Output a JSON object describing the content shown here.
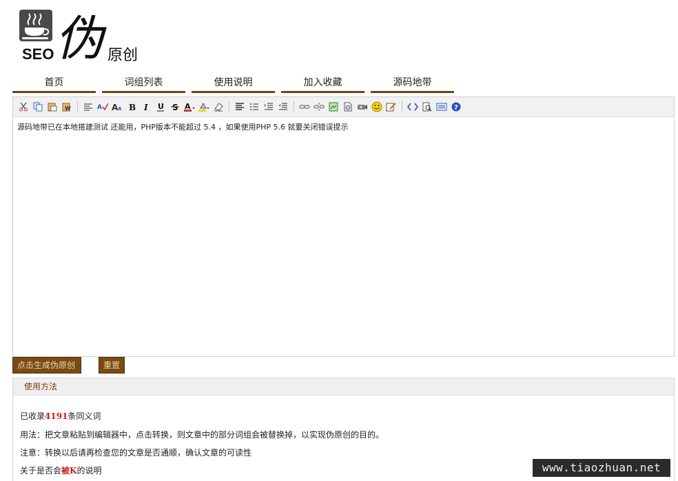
{
  "logo": {
    "seo_text": "SEO",
    "big_char": "伪",
    "small_text": "原创",
    "icon": "coffee-cup-icon"
  },
  "nav": {
    "items": [
      {
        "label": "首页"
      },
      {
        "label": "词组列表"
      },
      {
        "label": "使用说明"
      },
      {
        "label": "加入收藏"
      },
      {
        "label": "源码地带"
      }
    ]
  },
  "toolbar": {
    "buttons": [
      "cut-icon",
      "copy-icon",
      "paste-icon",
      "paste-text-icon",
      "format-icon",
      "spellcheck-icon",
      "font-size-icon",
      "bold-icon",
      "italic-icon",
      "underline-icon",
      "strikethrough-icon",
      "text-color-icon",
      "highlight-icon",
      "eraser-icon",
      "align-icon",
      "unordered-list-icon",
      "indent-icon",
      "outdent-icon",
      "link-icon",
      "unlink-icon",
      "image-icon",
      "flash-icon",
      "media-icon",
      "emoticon-icon",
      "edit-icon",
      "source-icon",
      "preview-icon",
      "fullscreen-icon",
      "help-icon"
    ]
  },
  "editor": {
    "content": "源码地带已在本地搭建测试 还能用，PHP版本不能超过 5.4 ，如果使用PHP 5.6 就要关闭错误提示"
  },
  "actions": {
    "generate_label": "点击生成伪原创",
    "reset_label": "重置"
  },
  "usage": {
    "title": "使用方法",
    "line1_prefix": "已收录",
    "line1_count": "4191",
    "line1_suffix": "条同义词",
    "line2": "用法：把文章粘贴到编辑器中，点击转换，则文章中的部分词组会被替换掉，以实现伪原创的目的。",
    "line3": "注意：转换以后请再检查您的文章是否通顺，确认文章的可读性",
    "line4_prefix": "关于是否会",
    "line4_highlight": "被K",
    "line4_suffix": "的说明"
  },
  "watermark": {
    "text": "www.tiaozhuan.net"
  },
  "colors": {
    "accent": "#7a3e12",
    "button_bg": "#7a4a10",
    "highlight_red": "#cc1d1d"
  }
}
